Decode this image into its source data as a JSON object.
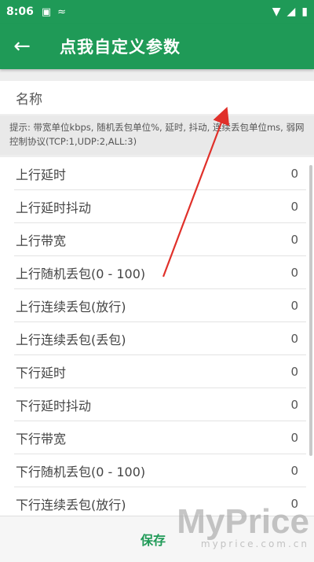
{
  "status_bar": {
    "time": "8:06",
    "icons": [
      "sim-card-icon",
      "cast-icon",
      "wifi-icon",
      "signal-icon",
      "battery-icon"
    ]
  },
  "app_bar": {
    "back_icon": "arrow-left-icon",
    "title": "点我自定义参数"
  },
  "name_field": {
    "label": "名称",
    "value": ""
  },
  "hint": "提示: 带宽单位kbps, 随机丢包单位%, 延时, 抖动, 连续丢包单位ms, 弱网控制协议(TCP:1,UDP:2,ALL:3)",
  "params": [
    {
      "label": "上行延时",
      "value": "0"
    },
    {
      "label": "上行延时抖动",
      "value": "0"
    },
    {
      "label": "上行带宽",
      "value": "0"
    },
    {
      "label": "上行随机丢包(0 - 100)",
      "value": "0"
    },
    {
      "label": "上行连续丢包(放行)",
      "value": "0"
    },
    {
      "label": "上行连续丢包(丢包)",
      "value": "0"
    },
    {
      "label": "下行延时",
      "value": "0"
    },
    {
      "label": "下行延时抖动",
      "value": "0"
    },
    {
      "label": "下行带宽",
      "value": "0"
    },
    {
      "label": "下行随机丢包(0 - 100)",
      "value": "0"
    },
    {
      "label": "下行连续丢包(放行)",
      "value": "0"
    }
  ],
  "bottom_bar": {
    "save_label": "保存"
  },
  "watermark": {
    "main": "MyPrice",
    "sub": "myprice.com.cn"
  },
  "colors": {
    "primary": "#1f9a57",
    "annotation_arrow": "#e0302a"
  }
}
